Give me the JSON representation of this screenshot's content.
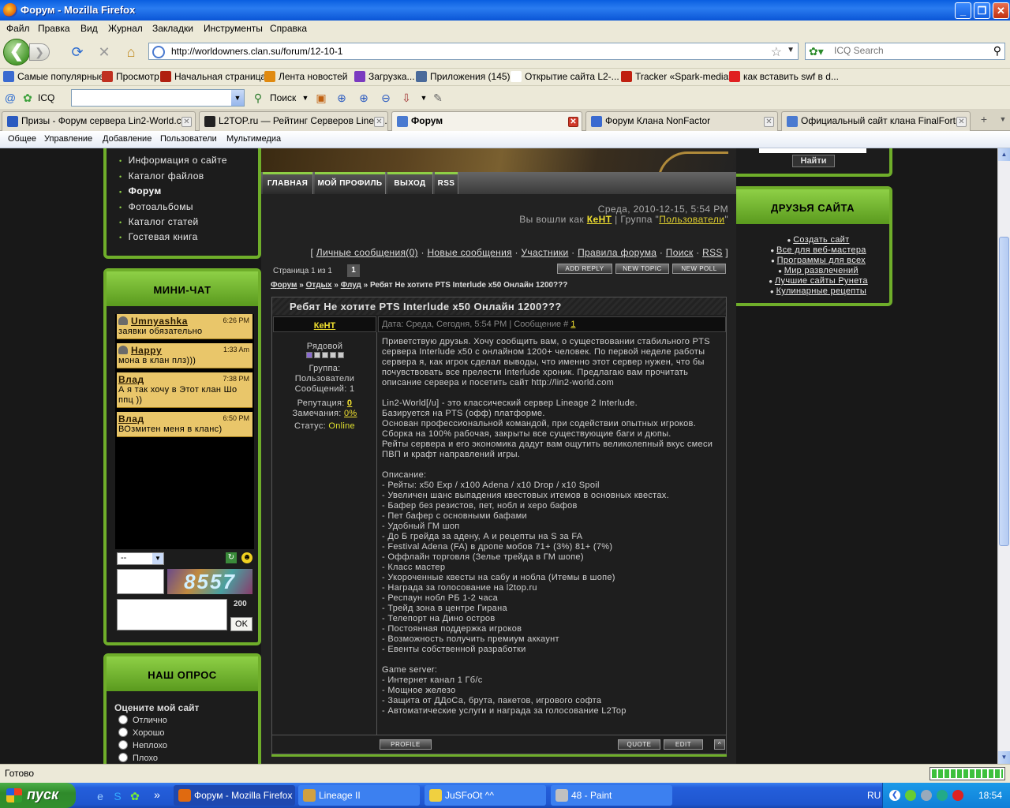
{
  "window": {
    "title": "Форум - Mozilla Firefox",
    "buttons": {
      "minimize": "_",
      "maximize": "❐",
      "close": "✕"
    }
  },
  "menubar": [
    "Файл",
    "Правка",
    "Вид",
    "Журнал",
    "Закладки",
    "Инструменты",
    "Справка"
  ],
  "nav": {
    "back": "❮",
    "forward": "❯",
    "url": "http://worldowners.clan.su/forum/12-10-1",
    "search_placeholder": "ICQ Search"
  },
  "bookmarks": [
    {
      "label": "Самые популярные",
      "icon": "bookmark-icon",
      "color": "#3a6ad0"
    },
    {
      "label": "Просмотр",
      "icon": "puzzle-icon",
      "color": "#c03020"
    },
    {
      "label": "Начальная страница",
      "icon": "dragon-icon",
      "color": "#b02010"
    },
    {
      "label": "Лента новостей",
      "icon": "rss-icon",
      "color": "#e08a10"
    },
    {
      "label": "Загрузка...",
      "icon": "loading-icon",
      "color": "#7a3ac0"
    },
    {
      "label": "Приложения (145)",
      "icon": "vk-icon",
      "color": "#4a6a9a"
    },
    {
      "label": "Открытие сайта L2-...",
      "icon": "page-icon",
      "color": "#ffffff"
    },
    {
      "label": "Tracker «Spark-media»",
      "icon": "spark-icon",
      "color": "#c02010"
    },
    {
      "label": "как вставить swf в d...",
      "icon": "yandex-icon",
      "color": "#e02020"
    }
  ],
  "icqbar": {
    "icq": "ICQ",
    "search": "Поиск"
  },
  "tabs": [
    {
      "label": "Призы - Форум сервера Lin2-World.c...",
      "active": false,
      "color": "#2a5ac0"
    },
    {
      "label": "L2TOP.ru — Рейтинг Серверов Linea...",
      "active": false,
      "color": "#222222"
    },
    {
      "label": "Форум",
      "active": true,
      "color": "#4a7ad0"
    },
    {
      "label": "Форум Клана NonFactor",
      "active": false,
      "color": "#3a6ad0"
    },
    {
      "label": "Официальный сайт клана FinalFortr...",
      "active": false,
      "color": "#4a7ad0"
    }
  ],
  "ucozbar": [
    "Общее",
    "Управление",
    "Добавление",
    "Пользователи",
    "Мультимедиа"
  ],
  "site_menu": [
    "Информация о сайте",
    "Каталог файлов",
    "Форум",
    "Фотоальбомы",
    "Каталог статей",
    "Гостевая книга"
  ],
  "minichat": {
    "title": "МИНИ-ЧАТ",
    "messages": [
      {
        "user": "Umnyashka",
        "time": "6:26 PM",
        "text": "заявки обязательно"
      },
      {
        "user": "Happy",
        "time": "1:33 Am",
        "text": "мона в клан плз)))"
      },
      {
        "user": "Влад",
        "time": "7:38 PM",
        "text": "А я так хочу в Этот клан Шо ппц ))"
      },
      {
        "user": "Влад",
        "time": "6:50 PM",
        "text": "ВОзмитен меня в кланс)"
      }
    ],
    "select_value": "--",
    "captcha": "8557",
    "counter": "200",
    "ok": "OK"
  },
  "poll": {
    "title": "НАШ ОПРОС",
    "question": "Оцените мой сайт",
    "options": [
      "Отлично",
      "Хорошо",
      "Неплохо",
      "Плохо"
    ]
  },
  "header_nav": [
    "ГЛАВНАЯ",
    "МОЙ ПРОФИЛЬ",
    "ВЫХОД",
    "RSS"
  ],
  "login": {
    "date": "Среда, 2010-12-15, 5:54 PM",
    "prefix": "Вы вошли как",
    "user": "КеНТ",
    "group_prefix": "| Группа \"",
    "group": "Пользователи",
    "group_suffix": "\""
  },
  "forum_links": [
    "Личные сообщения(0)",
    "Новые сообщения",
    "Участники",
    "Правила форума",
    "Поиск",
    "RSS"
  ],
  "paging": {
    "label": "Страница 1 из 1",
    "current": "1"
  },
  "action_buttons": [
    "ADD REPLY",
    "NEW TOPIC",
    "NEW POLL"
  ],
  "breadcrumb": {
    "items": [
      "Форум",
      "Отдых",
      "Флуд"
    ],
    "sep": "»",
    "current": "Ребят Не хотите PTS Interlude x50 Онлайн 1200???"
  },
  "post": {
    "title": "Ребят Не хотите PTS Interlude x50 Онлайн 1200???",
    "author": "КеНТ",
    "meta": "Дата: Среда, Сегодня, 5:54 PM | Сообщение #",
    "msg_num": "1",
    "rank": "Рядовой",
    "rank_level": 1,
    "rank_max": 5,
    "group_label": "Группа:",
    "group": "Пользователи",
    "messages": "Сообщений: 1",
    "rep_label": "Репутация:",
    "rep": "0",
    "warn_label": "Замечания:",
    "warn": "0%",
    "status_label": "Статус:",
    "status": "Online",
    "paragraphs": [
      "Приветствую друзья. Хочу сообщить вам, о существовании стабильного PTS сервера Interlude x50 с онлайном 1200+ человек. По первой неделе работы сервера я, как игрок сделал выводы, что именно этот сервер нужен, что бы почувствовать все прелести Interlude хроник. Предлагаю вам прочитать описание сервера и посетить сайт http://lin2-world.com",
      "Lin2-World[/u] - это классический сервер Lineage 2 Interlude.\nБазируется на PTS (офф) платформе.\nОснован профессиональной командой, при содействии опытных игроков.\nСборка на 100% рабочая, закрыты все существующие баги и дюпы.\nРейты сервера и его экономика дадут вам ощутить великолепный вкус смеси ПВП и крафт направлений игры.",
      "Описание:\n- Рейты: x50 Exp / x100 Adena / x10 Drop / x10 Spoil\n- Увеличен шанс выпадения квестовых итемов в основных квестах.\n- Бафер без резистов, пет, нобл и херо бафов\n- Пет бафер с основными бафами\n- Удобный ГМ шоп\n- До Б грейда за адену, А и рецепты на S за FA\n- Festival Adena (FA) в дропе мобов 71+ (3%) 81+ (7%)\n- Оффлайн торговля (Зелье трейда в ГМ шопе)\n- Класс мастер\n- Укороченные квесты на сабу и нобла (Итемы в шопе)\n- Награда за голосование на l2top.ru\n- Респаун нобл РБ 1-2 часа\n- Трейд зона в центре Гирана\n- Телепорт на Дино остров\n- Постоянная поддержка игроков\n- Возможность получить премиум аккаунт\n- Евенты собственной разработки",
      "Game server:\n- Интернет канал 1 Гб/с\n- Мощное железо\n- Защита от ДДоСа, брута, пакетов, игрового софта\n- Автоматические услуги и награда за голосование L2Top"
    ],
    "footer_buttons": [
      "PROFILE",
      "QUOTE",
      "EDIT",
      "^"
    ]
  },
  "right": {
    "search_button": "Найти",
    "friends_title": "ДРУЗЬЯ САЙТА",
    "friends": [
      "Создать сайт",
      "Все для веб-мастера",
      "Программы для всех",
      "Мир развлечений",
      "Лучшие сайты Рунета",
      "Кулинарные рецепты"
    ]
  },
  "statusbar": {
    "text": "Готово",
    "progress": 1.0
  },
  "taskbar": {
    "start": "пуск",
    "tasks": [
      {
        "label": "Форум - Mozilla Firefox",
        "active": true,
        "color": "#e06a10"
      },
      {
        "label": "Lineage II",
        "active": false,
        "color": "#d0a040"
      },
      {
        "label": "JuSFoOt ^^",
        "active": false,
        "color": "#f0d040"
      },
      {
        "label": "48 - Paint",
        "active": false,
        "color": "#c0c0c0"
      }
    ],
    "lang": "RU",
    "clock": "18:54"
  },
  "colors": {
    "accent_green": "#6fae2a",
    "link_yellow": "#f0e030",
    "online": "#e0e030"
  }
}
